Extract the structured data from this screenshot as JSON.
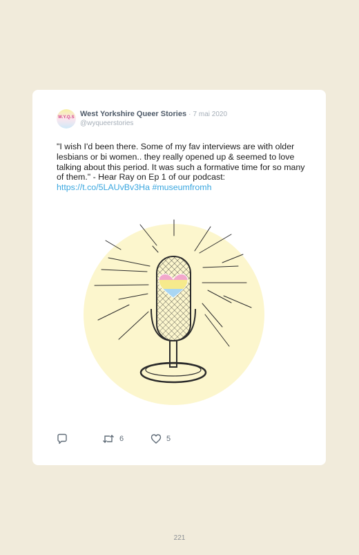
{
  "tweet": {
    "avatar_text": "W.Y.Q.S",
    "author_name": "West Yorkshire Queer Stories",
    "separator": "·",
    "date": "7 mai 2020",
    "handle": "@wyqueerstories",
    "text": "\"I wish I'd been there. Some of my fav interviews are with older lesbians or bi women.. they really opened up & seemed to love talking about this period. It was such a formative time for so many of them.\" - Hear Ray on Ep 1 of our podcast: ",
    "link": "https://t.co/5LAUvBv3Ha",
    "hashtag": "#museumfromh",
    "retweet_count": "6",
    "like_count": "5",
    "reply_icon": "reply-icon",
    "retweet_icon": "retweet-icon",
    "like_icon": "heart-icon"
  },
  "colors": {
    "page_background": "#f1ebdb",
    "card_background": "#ffffff",
    "link": "#39a6df",
    "illustration_circle": "#fcf6cd",
    "heart_pink": "#f2a8cb",
    "heart_yellow": "#f6ea8c",
    "heart_blue": "#a9d6f2"
  },
  "page_number": "221"
}
